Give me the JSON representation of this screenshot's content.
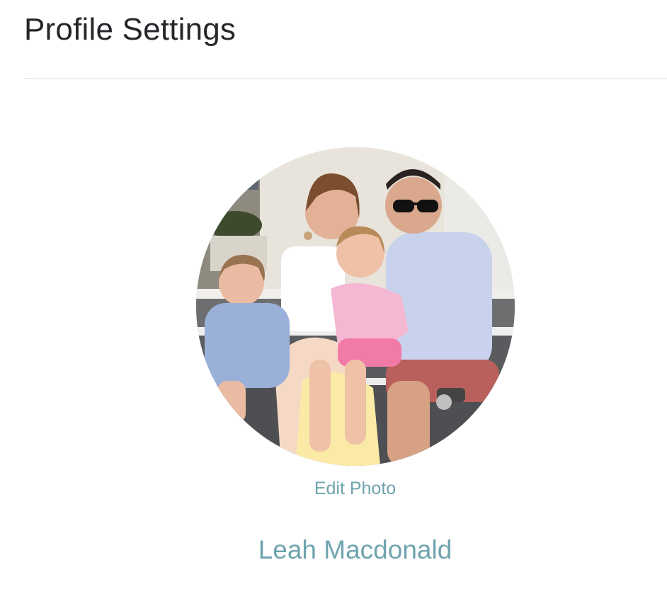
{
  "header": {
    "title": "Profile Settings"
  },
  "profile": {
    "photo_alt": "Profile photo",
    "photo_icon": "profile-photo",
    "edit_photo_label": "Edit Photo",
    "name": "Leah Macdonald"
  },
  "colors": {
    "accent": "#6ea4ad",
    "title_text": "#24262a",
    "divider": "#e3e5e7",
    "background": "#ffffff"
  }
}
